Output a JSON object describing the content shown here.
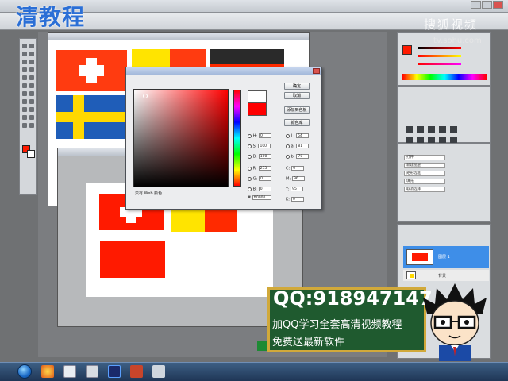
{
  "watermark": {
    "logo_text": "清教程",
    "site_mark": "搜狐视频",
    "site_url": "tv.sohu.com"
  },
  "promo": {
    "qq": "QQ:918947147",
    "line1": "加QQ学习全套高清视频教程",
    "line2": "免费送最新软件"
  },
  "color_picker": {
    "ok_label": "确定",
    "cancel_label": "取消",
    "add_to_swatches_label": "添加到色板",
    "color_libraries_label": "颜色库",
    "only_web_colors_label": "只有 Web 颜色",
    "fields": [
      {
        "label": "H:",
        "value": "0"
      },
      {
        "label": "S:",
        "value": "100"
      },
      {
        "label": "B:",
        "value": "100"
      },
      {
        "label": "R:",
        "value": "255"
      },
      {
        "label": "G:",
        "value": "0"
      },
      {
        "label": "B:",
        "value": "0"
      }
    ],
    "lab_fields": [
      {
        "label": "L:",
        "value": "54"
      },
      {
        "label": "a:",
        "value": "81"
      },
      {
        "label": "b:",
        "value": "70"
      }
    ],
    "cmyk_fields": [
      {
        "label": "C:",
        "value": "0"
      },
      {
        "label": "M:",
        "value": "96"
      },
      {
        "label": "Y:",
        "value": "95"
      },
      {
        "label": "K:",
        "value": "0"
      }
    ],
    "hex_value": "ff0000"
  },
  "layers": {
    "layer1_label": "图层 1",
    "layer2_label": "背景"
  },
  "history_items": [
    "打开",
    "新建图层",
    "矩形选框",
    "填充",
    "取消选择"
  ],
  "colors": {
    "accent_red": "#ff1a00",
    "flag_yellow": "#ffe400",
    "flag_blue": "#1f5db8",
    "promo_green": "#1f5a2f",
    "layer_highlight": "#3e8ee8"
  }
}
